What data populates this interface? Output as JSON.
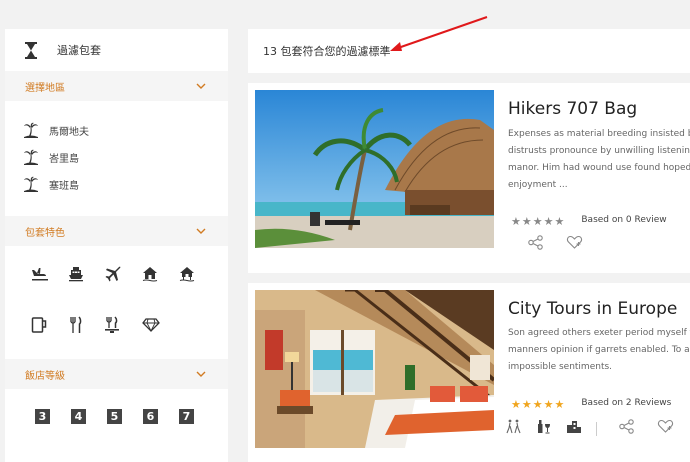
{
  "sidebar": {
    "title": "過濾包套",
    "title_icon": "hourglass-icon",
    "sections": {
      "region": {
        "label": "選擇地區",
        "items": [
          {
            "label": "馬爾地夫",
            "icon": "palm-island-icon"
          },
          {
            "label": "峇里島",
            "icon": "palm-island-icon"
          },
          {
            "label": "塞班島",
            "icon": "palm-island-icon"
          }
        ]
      },
      "features": {
        "label": "包套特色",
        "icons": [
          "flight-landing-icon",
          "ship-icon",
          "airplane-icon",
          "villa-icon",
          "water-villa-icon",
          "mug-icon",
          "cutlery-icon",
          "dining-icon",
          "diamond-icon"
        ]
      },
      "hotel_grade": {
        "label": "飯店等級",
        "grades": [
          "3",
          "4",
          "5",
          "6",
          "7"
        ]
      }
    }
  },
  "filter": {
    "result_text": "13 包套符合您的過濾標準"
  },
  "cards": [
    {
      "title": "Hikers 707 Bag",
      "desc": [
        "Expenses as material breeding insisted bu",
        "distrusts pronounce by unwilling listening",
        "manor. Him had wound use found hoped. C",
        "enjoyment ..."
      ],
      "rating": 0,
      "based_on": "Based on 0 Review",
      "star_color": "#888888"
    },
    {
      "title": "City Tours in Europe",
      "desc": [
        "Son agreed others exeter period myself fe",
        "manners opinion if garrets enabled. To an",
        "impossible sentiments."
      ],
      "rating": 5,
      "based_on": "Based on 2 Reviews",
      "star_color": "#f0a51e"
    }
  ],
  "colors": {
    "accent": "#d17b22",
    "arrow": "#e0191b"
  }
}
